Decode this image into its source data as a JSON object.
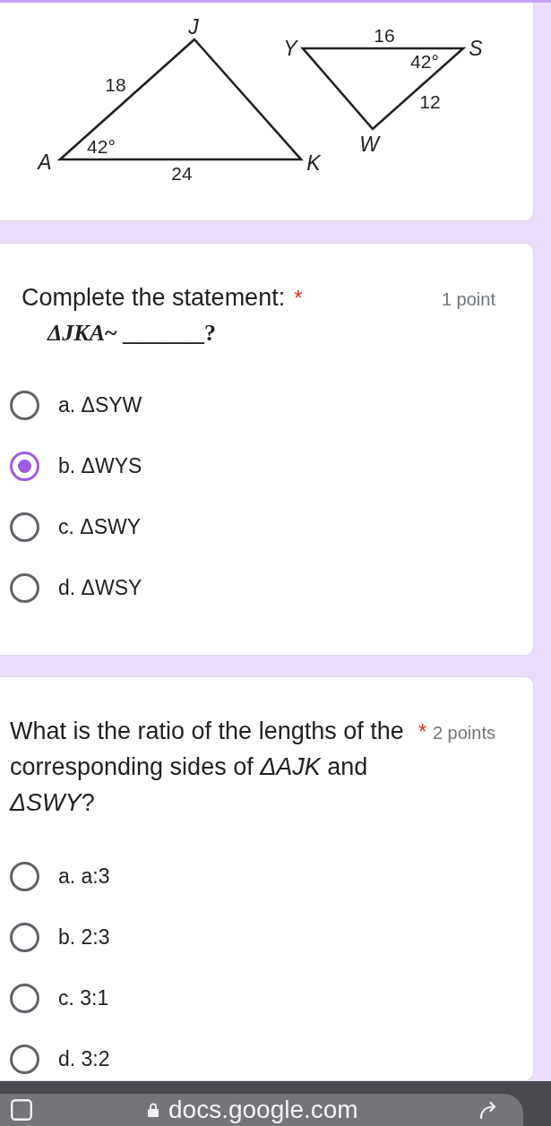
{
  "figure": {
    "triangles": [
      {
        "vertex_labels": [
          "J",
          "A",
          "K"
        ],
        "side_labels": [
          "18",
          "24"
        ],
        "angle_label": "42°"
      },
      {
        "vertex_labels": [
          "Y",
          "S",
          "W"
        ],
        "side_labels": [
          "16",
          "12"
        ],
        "angle_label": "42°"
      }
    ]
  },
  "questions": [
    {
      "title": "Complete the statement:",
      "required_mark": "*",
      "points": "1 point",
      "statement": "*ΔJKA*~ _______?",
      "options": [
        {
          "label": "a. ΔSYW",
          "selected": false
        },
        {
          "label": "b. ΔWYS",
          "selected": true
        },
        {
          "label": "c. ΔSWY",
          "selected": false
        },
        {
          "label": "d. ΔWSY",
          "selected": false
        }
      ]
    },
    {
      "title": "What is the ratio of the lengths of the corresponding sides of *ΔAJK* and *ΔSWY*?",
      "required_mark": "*",
      "points": "2 points",
      "options": [
        {
          "label": "a. a:3",
          "selected": false
        },
        {
          "label": "b. 2:3",
          "selected": false
        },
        {
          "label": "c. 3:1",
          "selected": false
        },
        {
          "label": "d. 3:2",
          "selected": false
        }
      ]
    }
  ],
  "browser_bar": {
    "url": "docs.google.com"
  }
}
